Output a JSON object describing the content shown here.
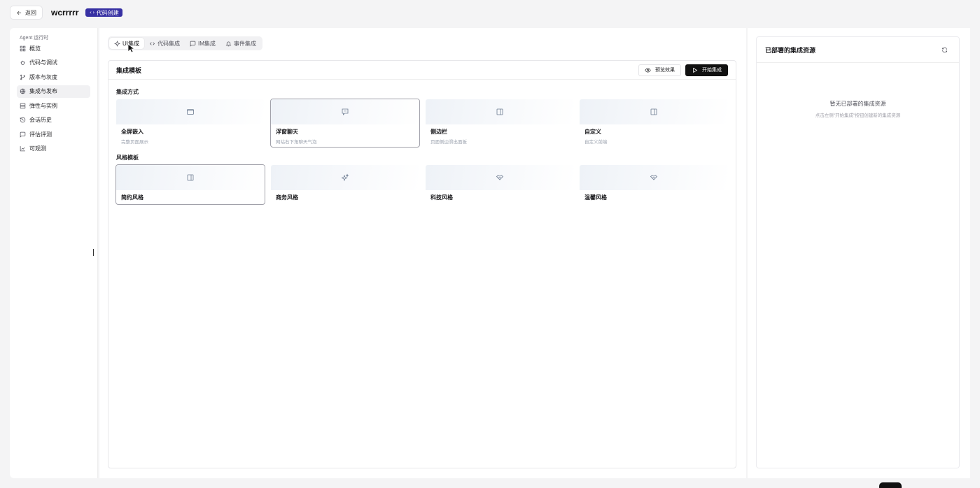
{
  "topbar": {
    "back_label": "返回",
    "app_title": "wcrrrrr",
    "badge_code": "‹›",
    "badge_label": "代码创建"
  },
  "sidebar": {
    "heading": "Agent 运行时",
    "items": [
      {
        "label": "概览",
        "icon": "grid-icon"
      },
      {
        "label": "代码与调试",
        "icon": "bug-icon"
      },
      {
        "label": "版本与灰度",
        "icon": "git-branch-icon"
      },
      {
        "label": "集成与发布",
        "icon": "globe-icon",
        "active": true
      },
      {
        "label": "弹性与实例",
        "icon": "server-icon"
      },
      {
        "label": "会话历史",
        "icon": "history-icon"
      },
      {
        "label": "评估评测",
        "icon": "message-square-icon"
      },
      {
        "label": "可观测",
        "icon": "line-chart-icon"
      }
    ]
  },
  "tabs": [
    {
      "label": "UI集成",
      "icon": "sparkle-icon",
      "active": true
    },
    {
      "label": "代码集成",
      "icon": "code-icon"
    },
    {
      "label": "IM集成",
      "icon": "message-icon"
    },
    {
      "label": "事件集成",
      "icon": "bell-icon"
    }
  ],
  "panel": {
    "title": "集成模板",
    "preview_label": "预览效果",
    "start_label": "开始集成"
  },
  "methods": {
    "label": "集成方式",
    "items": [
      {
        "name": "全屏嵌入",
        "desc": "完整页面展示",
        "icon": "browser-icon"
      },
      {
        "name": "浮窗聊天",
        "desc": "网站右下角聊天气泡",
        "icon": "chat-bubble-icon",
        "selected": true
      },
      {
        "name": "侧边栏",
        "desc": "页面侧边滑出面板",
        "icon": "panel-right-icon"
      },
      {
        "name": "自定义",
        "desc": "自定义前端",
        "icon": "panel-right-icon"
      }
    ]
  },
  "styles": {
    "label": "风格模板",
    "items": [
      {
        "name": "简约风格",
        "icon": "panel-right-icon",
        "selected": true
      },
      {
        "name": "商务风格",
        "icon": "sparkles-icon"
      },
      {
        "name": "科技风格",
        "icon": "handshake-icon"
      },
      {
        "name": "温馨风格",
        "icon": "handshake-icon"
      }
    ]
  },
  "deployed": {
    "title": "已部署的集成资源",
    "empty_title": "暂无已部署的集成资源",
    "empty_sub": "点击左侧\"开始集成\"按钮创建新的集成资源"
  }
}
